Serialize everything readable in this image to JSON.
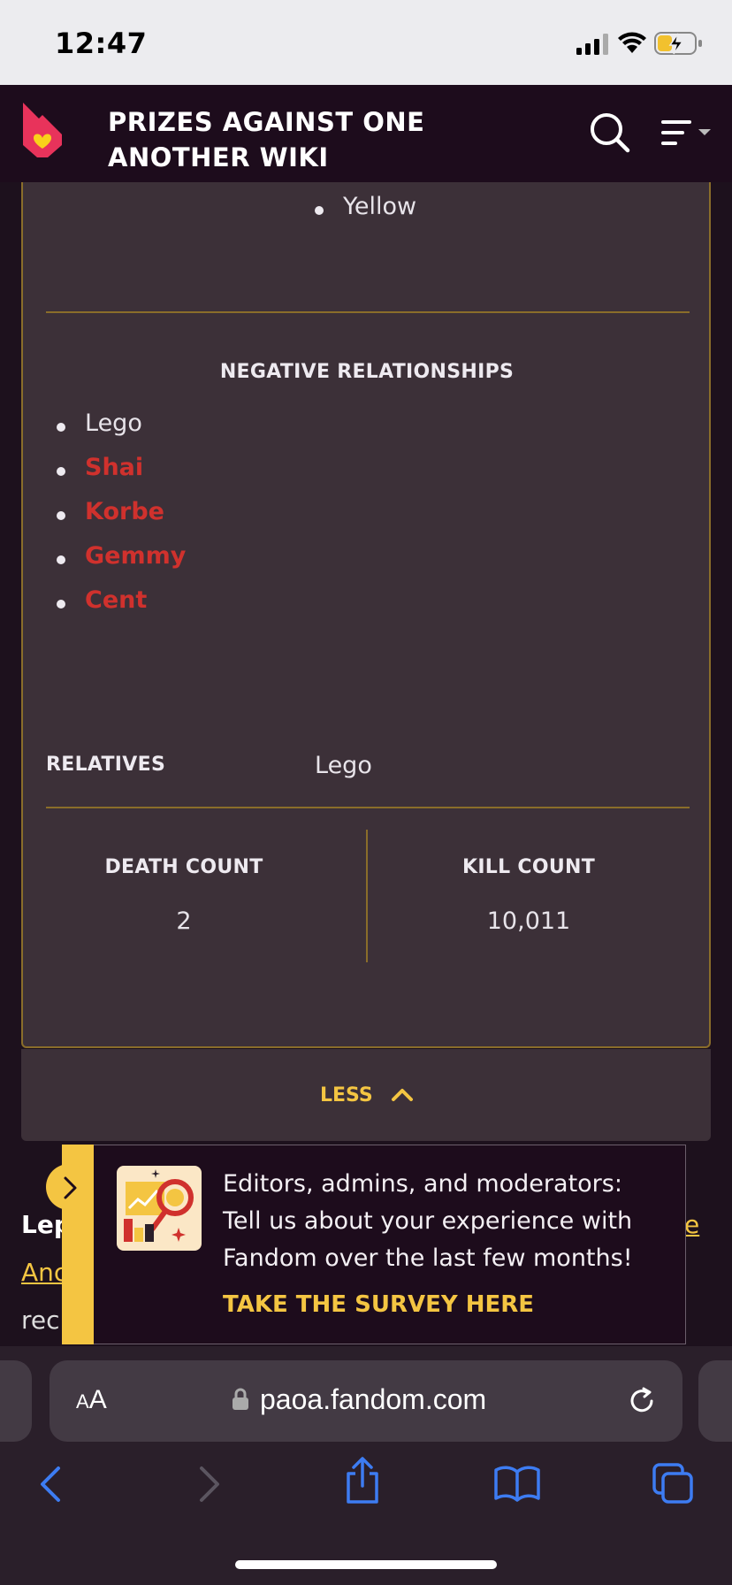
{
  "status_bar": {
    "time": "12:47"
  },
  "header": {
    "title_line1": "PRIZES AGAINST ONE",
    "title_line2": "ANOTHER WIKI"
  },
  "infobox": {
    "top_list": [
      "Yellow"
    ],
    "negative_relationships": {
      "heading": "NEGATIVE RELATIONSHIPS",
      "items": [
        {
          "label": "Lego",
          "style": "plain"
        },
        {
          "label": "Shai",
          "style": "redlink"
        },
        {
          "label": "Korbe",
          "style": "redlink"
        },
        {
          "label": "Gemmy",
          "style": "redlink"
        },
        {
          "label": "Cent",
          "style": "redlink"
        }
      ]
    },
    "relatives": {
      "label": "RELATIVES",
      "value": "Lego"
    },
    "death_count": {
      "label": "DEATH COUNT",
      "value": "2"
    },
    "kill_count": {
      "label": "KILL COUNT",
      "value": "10,011"
    }
  },
  "less_button": {
    "label": "LESS"
  },
  "article_fragments": {
    "line1_start": "Lep",
    "line1_end": "e",
    "line2_start": "Anc",
    "line3_start": "rec"
  },
  "survey": {
    "message": "Editors, admins, and moderators: Tell us about your experience with Fandom over the last few months!",
    "link": "TAKE THE SURVEY HERE"
  },
  "browser": {
    "text_size_label": "AA",
    "url": "paoa.fandom.com"
  },
  "colors": {
    "accent": "#f4c542",
    "redlink": "#d0312d",
    "infobox_bg": "#3c3038",
    "border": "#8a6d2a",
    "header_bg": "#1d0c1c",
    "ios_blue": "#3d7cf2"
  }
}
